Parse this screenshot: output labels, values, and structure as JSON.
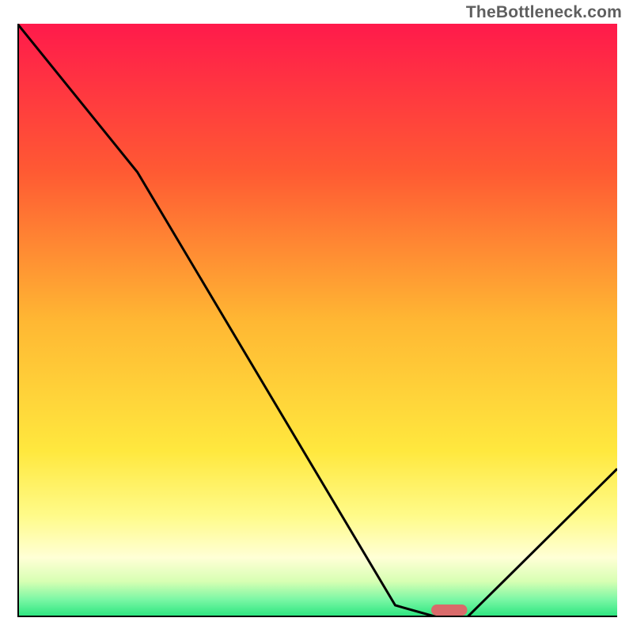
{
  "watermark": "TheBottleneck.com",
  "chart_data": {
    "type": "line",
    "title": "",
    "xlabel": "",
    "ylabel": "",
    "xlim": [
      0,
      100
    ],
    "ylim": [
      0,
      100
    ],
    "x": [
      0,
      20,
      63,
      70,
      75,
      100
    ],
    "values": [
      100,
      75,
      2,
      0,
      0,
      25
    ],
    "marker": {
      "x": 72,
      "y": 0,
      "width": 6,
      "color": "#d96a6a"
    },
    "gradient_stops": [
      {
        "offset": 0,
        "color": "#ff1a4b"
      },
      {
        "offset": 25,
        "color": "#ff5a33"
      },
      {
        "offset": 50,
        "color": "#ffb733"
      },
      {
        "offset": 72,
        "color": "#ffe83e"
      },
      {
        "offset": 83,
        "color": "#fffb8a"
      },
      {
        "offset": 90,
        "color": "#ffffd6"
      },
      {
        "offset": 94,
        "color": "#d7ffb3"
      },
      {
        "offset": 97,
        "color": "#7cf7a5"
      },
      {
        "offset": 100,
        "color": "#27e57e"
      }
    ],
    "axis_color": "#000000",
    "line_color": "#000000"
  }
}
